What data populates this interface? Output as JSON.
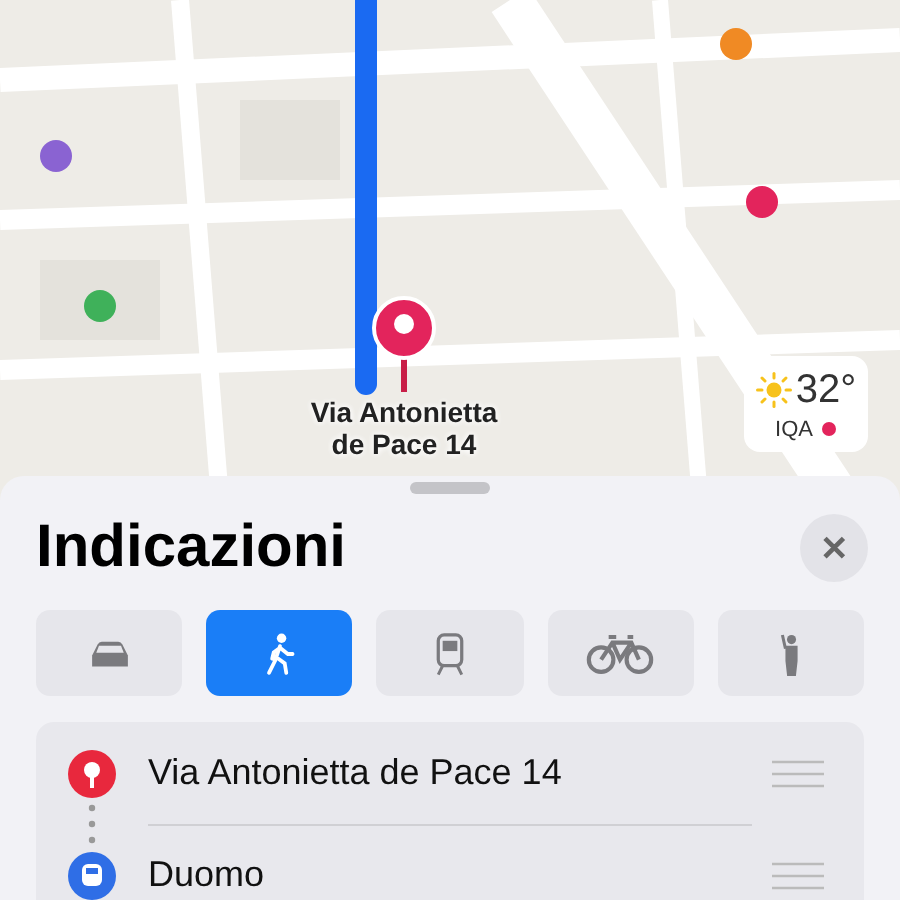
{
  "map": {
    "destination_label": "Via Antonietta de Pace 14",
    "weather": {
      "temperature": "32°",
      "aqi_label": "IQA",
      "aqi_dot": {
        "color": "#e3245c"
      }
    }
  },
  "sheet": {
    "title": "Indicazioni",
    "close": "✕"
  },
  "modes": [
    {
      "kind": "car",
      "selected": false
    },
    {
      "kind": "walk",
      "selected": true
    },
    {
      "kind": "train",
      "selected": false
    },
    {
      "kind": "bike",
      "selected": false
    },
    {
      "kind": "hail",
      "selected": false
    }
  ],
  "stops": [
    {
      "kind": "pin",
      "label": "Via Antonietta de Pace 14"
    },
    {
      "kind": "transit",
      "label": "Duomo"
    }
  ]
}
